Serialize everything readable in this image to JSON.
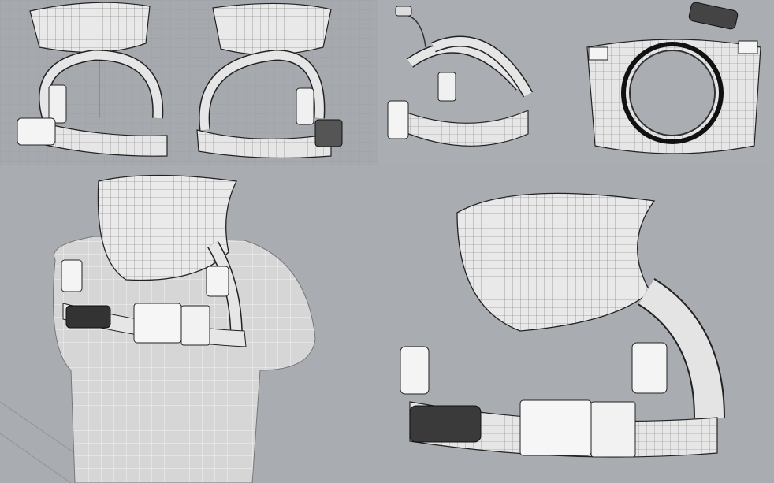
{
  "viewports": [
    {
      "id": "front",
      "shape": "collar-orthographic-front"
    },
    {
      "id": "back",
      "shape": "collar-orthographic-back"
    },
    {
      "id": "perspective",
      "shape": "harness-strap-perspective"
    },
    {
      "id": "top",
      "shape": "collar-orthographic-top"
    },
    {
      "id": "body",
      "shape": "collar-on-torso-rendered"
    },
    {
      "id": "detail",
      "shape": "collar-closeup-rendered"
    }
  ],
  "colors": {
    "background": "#a9adb3",
    "grid_line": "#9ea2a7",
    "mesh_fill": "#e6e6e6",
    "mesh_line": "#2a2a2a",
    "axis_green": "#3a9a3a",
    "axis_red": "#b94040"
  }
}
